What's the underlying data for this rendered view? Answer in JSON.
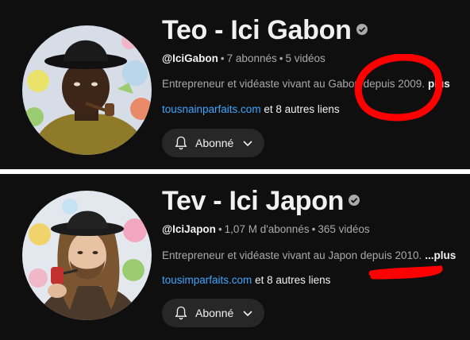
{
  "channels": [
    {
      "name": "Teo - Ici Gabon",
      "handle": "@IciGabon",
      "subscribers": "7 abonnés",
      "videos": "5 vidéos",
      "description": "Entrepreneur et vidéaste vivant au Gabon depuis 2009.",
      "more": "plus",
      "link": "tousnainparfaits.com",
      "other_links": "et 8 autres liens",
      "subscribe_label": "Abonné"
    },
    {
      "name": "Tev - Ici Japon",
      "handle": "@IciJapon",
      "subscribers": "1,07 M d'abonnés",
      "videos": "365 vidéos",
      "description": "Entrepreneur et vidéaste vivant au Japon depuis 2010.",
      "more": "...plus",
      "link": "tousimparfaits.com",
      "other_links": "et 8 autres liens",
      "subscribe_label": "Abonné"
    }
  ],
  "colors": {
    "background": "#0f0f0f",
    "link": "#3ea6ff",
    "annotation": "#ff0000",
    "button": "#272727"
  },
  "icons": [
    "verified-badge-icon",
    "bell-icon",
    "chevron-down-icon"
  ]
}
